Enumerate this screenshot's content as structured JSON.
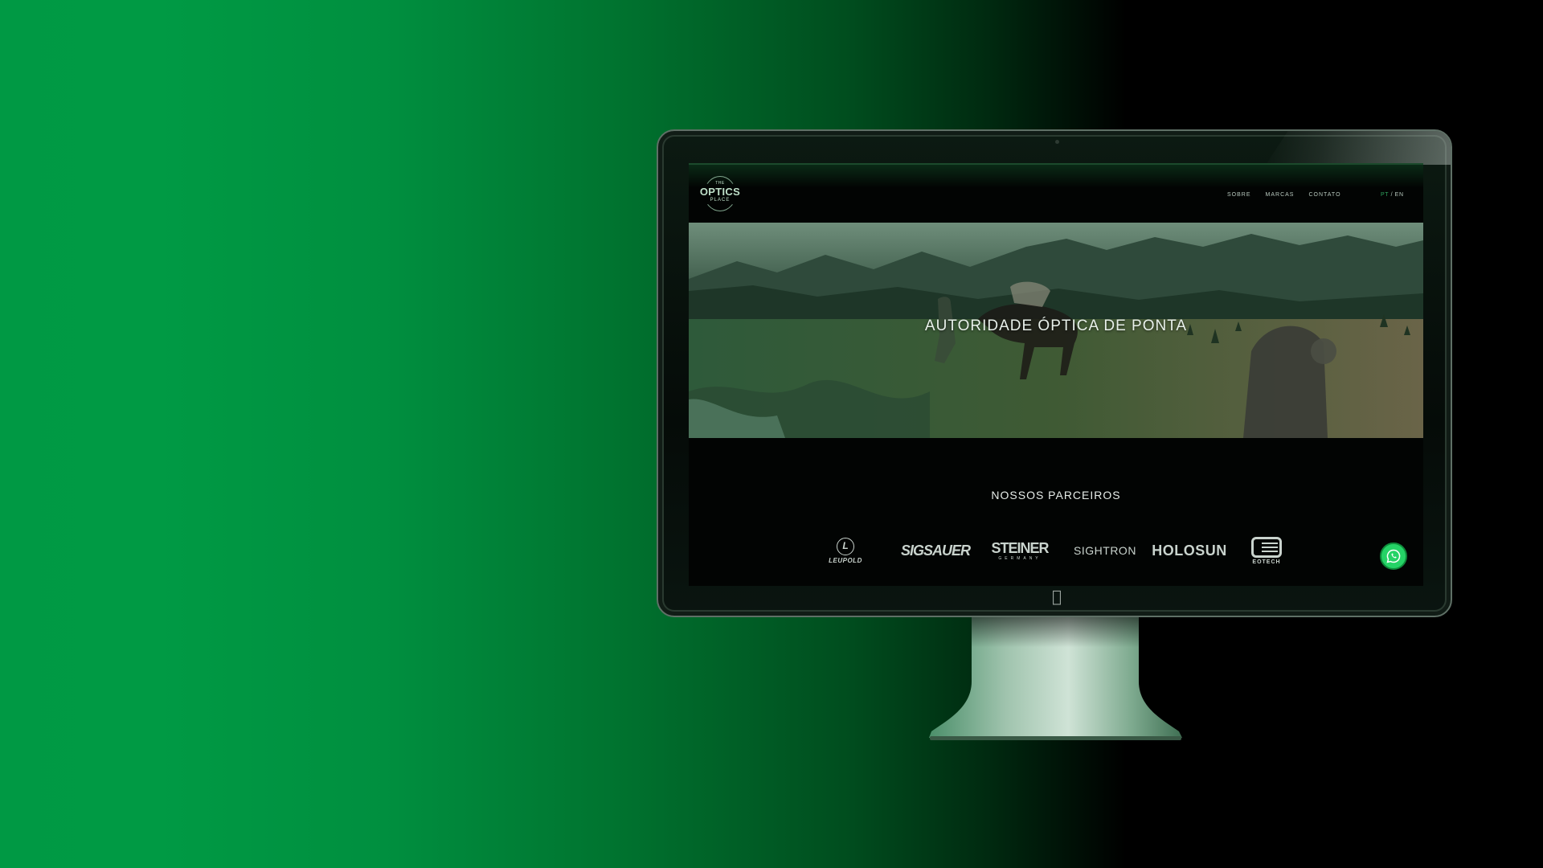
{
  "site": {
    "logo": {
      "the": "THE",
      "main": "OPTICS",
      "place": "PLACE"
    },
    "nav": [
      {
        "label": "SOBRE"
      },
      {
        "label": "MARCAS"
      },
      {
        "label": "CONTATO"
      }
    ],
    "language": {
      "pt": "PT",
      "separator": "/",
      "en": "EN",
      "active": "PT"
    },
    "hero": {
      "title": "AUTORIDADE ÓPTICA DE PONTA"
    },
    "partners": {
      "title": "NOSSOS PARCEIROS",
      "brands": [
        {
          "name": "LEUPOLD",
          "icon": "leupold-logo"
        },
        {
          "name": "SIGSAUER",
          "icon": "sigsauer-logo"
        },
        {
          "name": "STEINER",
          "sub": "GERMANY",
          "icon": "steiner-logo"
        },
        {
          "name": "SIGHTRON",
          "icon": "sightron-logo"
        },
        {
          "name": "HOLOSUN",
          "icon": "holosun-logo"
        },
        {
          "name": "EOTECH",
          "icon": "eotech-logo"
        }
      ]
    },
    "whatsapp": {
      "icon": "whatsapp-icon"
    }
  },
  "colors": {
    "brand_green": "#009a44",
    "accent_green": "#2fa35e",
    "whatsapp_green": "#25d366"
  }
}
